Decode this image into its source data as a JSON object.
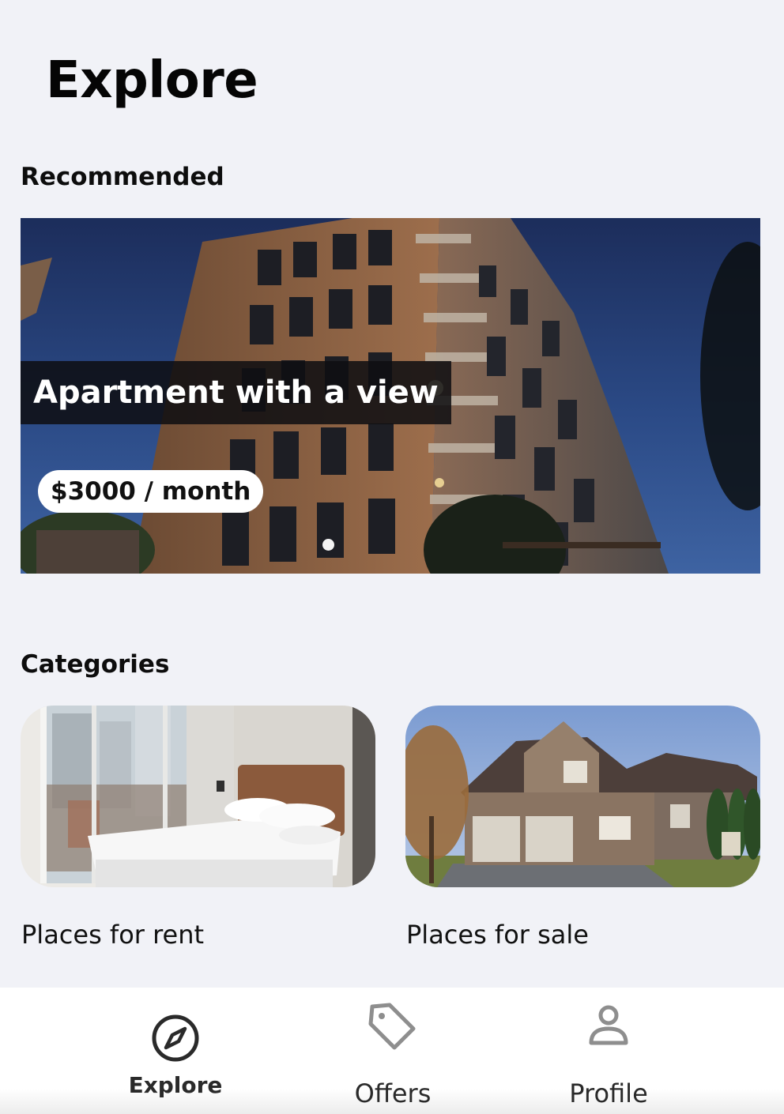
{
  "header": {
    "title": "Explore"
  },
  "recommended": {
    "heading": "Recommended",
    "listing": {
      "title": "Apartment with a view",
      "price": "$3000 / month"
    },
    "carousel_dot_count": 1
  },
  "categories": {
    "heading": "Categories",
    "items": [
      {
        "label": "Places for rent",
        "image": "bedroom-photo"
      },
      {
        "label": "Places for sale",
        "image": "house-photo"
      }
    ]
  },
  "tab_bar": {
    "active": "Explore",
    "tabs": [
      {
        "label": "Explore",
        "icon": "compass-icon"
      },
      {
        "label": "Offers",
        "icon": "tag-icon"
      },
      {
        "label": "Profile",
        "icon": "user-icon"
      }
    ]
  }
}
